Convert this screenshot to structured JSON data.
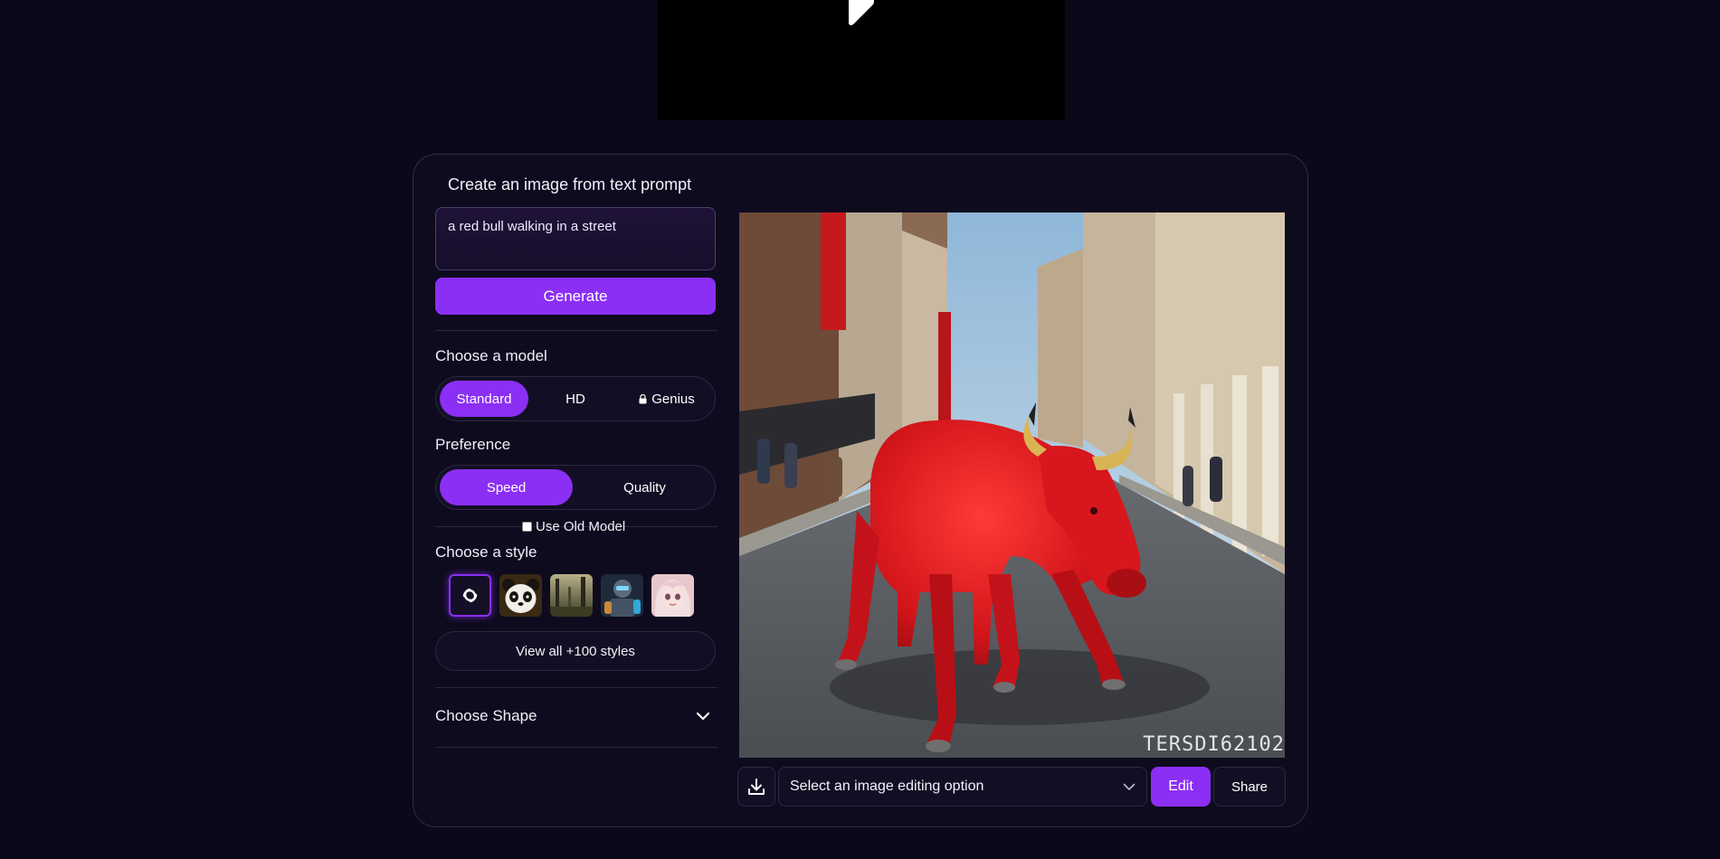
{
  "video": {
    "play_icon": "play-icon"
  },
  "creator": {
    "title": "Create an image from text prompt",
    "prompt_value": "a red bull walking in a street",
    "generate_label": "Generate",
    "model": {
      "label": "Choose a model",
      "options": [
        {
          "label": "Standard",
          "active": true
        },
        {
          "label": "HD",
          "active": false
        },
        {
          "label": "Genius",
          "active": false,
          "icon": "lock-icon"
        }
      ]
    },
    "preference": {
      "label": "Preference",
      "options": [
        {
          "label": "Speed",
          "active": true
        },
        {
          "label": "Quality",
          "active": false
        }
      ]
    },
    "old_model_label": "Use Old Model",
    "style": {
      "label": "Choose a style",
      "view_all_label": "View all +100 styles"
    },
    "shape_label": "Choose Shape"
  },
  "result": {
    "watermark": "TERSDI62102",
    "select_placeholder": "Select an image editing option",
    "edit_label": "Edit",
    "share_label": "Share"
  },
  "colors": {
    "accent": "#8b2ff5",
    "background": "#0b0819",
    "card": "#0e0b1e"
  }
}
